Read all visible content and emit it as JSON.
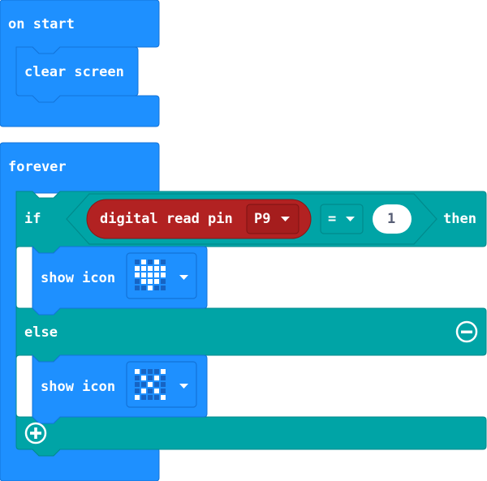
{
  "colors": {
    "basic": "#1e90ff",
    "basic_dark": "#1373d8",
    "logic": "#00a4a6",
    "logic_dark": "#008a8c",
    "pins": "#b22222",
    "pins_dark": "#8a1515"
  },
  "on_start": {
    "label": "on start",
    "clear_screen_label": "clear screen"
  },
  "forever": {
    "label": "forever",
    "if_label": "if",
    "then_label": "then",
    "else_label": "else",
    "condition": {
      "reporter_label": "digital read pin",
      "pin_value": "P9",
      "operator": "=",
      "compare_value": "1"
    },
    "show_icon_label": "show icon",
    "show_icon_then": {
      "icon_name": "heart-icon"
    },
    "show_icon_else": {
      "icon_name": "no-icon"
    },
    "remove_else_icon": "minus-circle-icon",
    "add_branch_icon": "plus-circle-icon"
  }
}
